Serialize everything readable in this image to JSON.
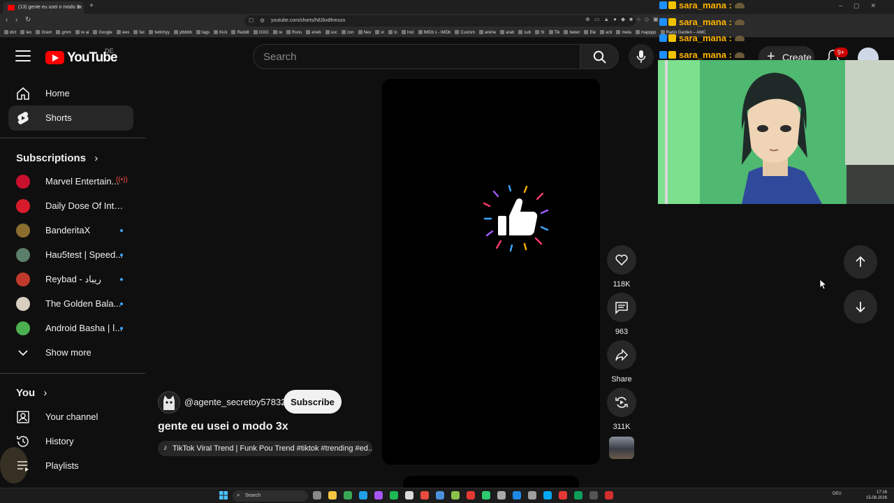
{
  "browser": {
    "tab_title": "(13) gente eu usei o modo 3x",
    "url": "youtube.com/shorts/h82kx8hmszo",
    "bookmarks": [
      "dict",
      "leo",
      "Gram",
      "gmm",
      "re ai",
      "Google",
      "wes",
      "fac",
      "twitchyy",
      "ytbbbb",
      "tags",
      "Kick",
      "Reddit",
      "GGG",
      "re",
      "Runs",
      "eneb",
      "soc",
      "zon",
      "Nex",
      "vr",
      "tc",
      "Inst",
      "IMDb s - IMDb",
      "Custom",
      "anime",
      "arab",
      "sub",
      "St",
      "Tik",
      "beten",
      "Ele",
      "acti",
      "meta",
      "mapppp",
      "Radio Garden – AMC"
    ]
  },
  "header": {
    "logo_text": "YouTube",
    "country_code": "DE",
    "search_placeholder": "Search",
    "create_label": "Create",
    "notifications_badge": "9+"
  },
  "sidebar": {
    "main": [
      {
        "label": "Home",
        "icon": "home-icon"
      },
      {
        "label": "Shorts",
        "icon": "shorts-icon"
      }
    ],
    "subscriptions_title": "Subscriptions",
    "subscriptions": [
      {
        "label": "Marvel Entertain...",
        "indicator": "live",
        "color": "#c8102e"
      },
      {
        "label": "Daily Dose Of Inter...",
        "indicator": "",
        "color": "#d81b2b"
      },
      {
        "label": "BanderitaX",
        "indicator": "dot",
        "color": "#8a6d2f"
      },
      {
        "label": "Hau5test | Speed...",
        "indicator": "dot",
        "color": "#5b7f6a"
      },
      {
        "label": "Reybad - ريباد",
        "indicator": "dot",
        "color": "#c0392b"
      },
      {
        "label": "The Golden Bala...",
        "indicator": "dot",
        "color": "#d9cfc0"
      },
      {
        "label": "Android Basha | ا...",
        "indicator": "dot",
        "color": "#4caf50"
      }
    ],
    "show_more": "Show more",
    "you_title": "You",
    "you_items": [
      {
        "label": "Your channel",
        "icon": "your-channel-icon"
      },
      {
        "label": "History",
        "icon": "history-icon"
      },
      {
        "label": "Playlists",
        "icon": "playlists-icon"
      }
    ]
  },
  "short": {
    "channel": "@agente_secretoy57832",
    "subscribe_label": "Subscribe",
    "title": "gente eu usei o modo 3x",
    "sound": "TikTok Viral Trend | Funk Pou Trend #tiktok #trending #ed...",
    "likes": "118K",
    "comments": "963",
    "share_label": "Share",
    "remixes": "311K"
  },
  "chat": {
    "lines": [
      "sara_mana :",
      "sara_mana :",
      "sara_mana :",
      "sara_mana :"
    ]
  },
  "taskbar": {
    "search_label": "Search",
    "lang": "DEU",
    "time": "17:16",
    "date": "15.08.2026"
  },
  "colors": {
    "background": "#0f0f0f",
    "brand_red": "#ff0000",
    "chat_name": "#ffb400"
  }
}
